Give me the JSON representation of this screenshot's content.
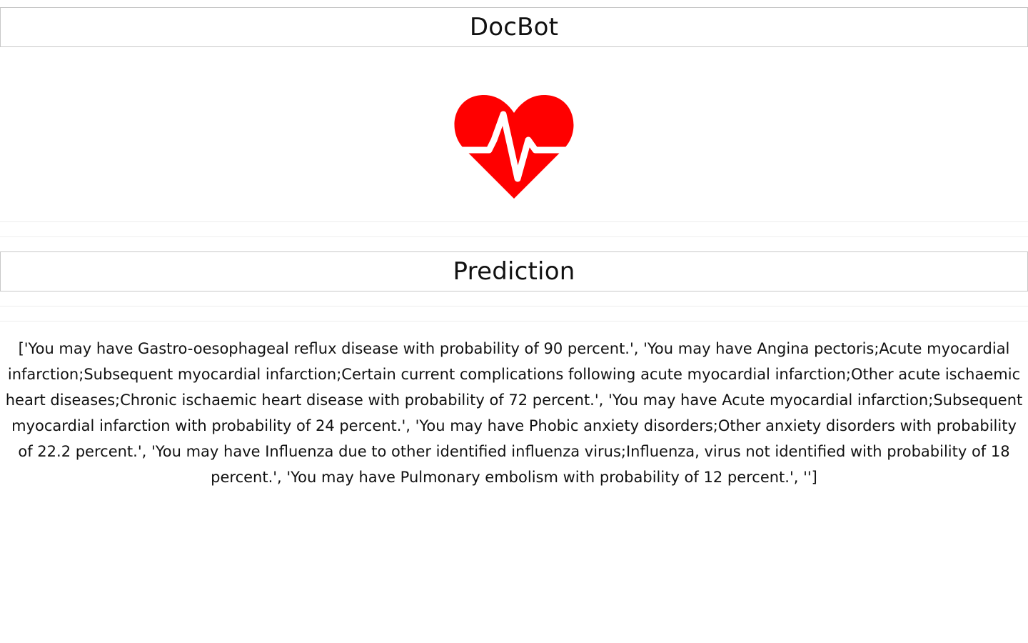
{
  "header": {
    "title": "DocBot"
  },
  "logo": {
    "icon": "heart-pulse-icon",
    "color": "#ff0000"
  },
  "prediction": {
    "title": "Prediction",
    "result_text": "['You may have Gastro-oesophageal reflux disease with probability of 90 percent.', 'You may have Angina pectoris;Acute myocardial infarction;Subsequent myocardial infarction;Certain current complications following acute myocardial infarction;Other acute ischaemic heart diseases;Chronic ischaemic heart disease with probability of 72 percent.', 'You may have Acute myocardial infarction;Subsequent myocardial infarction with probability of 24 percent.', 'You may have Phobic anxiety disorders;Other anxiety disorders with probability of 22.2 percent.', 'You may have Influenza due to other identified influenza virus;Influenza, virus not identified with probability of 18 percent.', 'You may have Pulmonary embolism with probability of 12 percent.', '']"
  }
}
